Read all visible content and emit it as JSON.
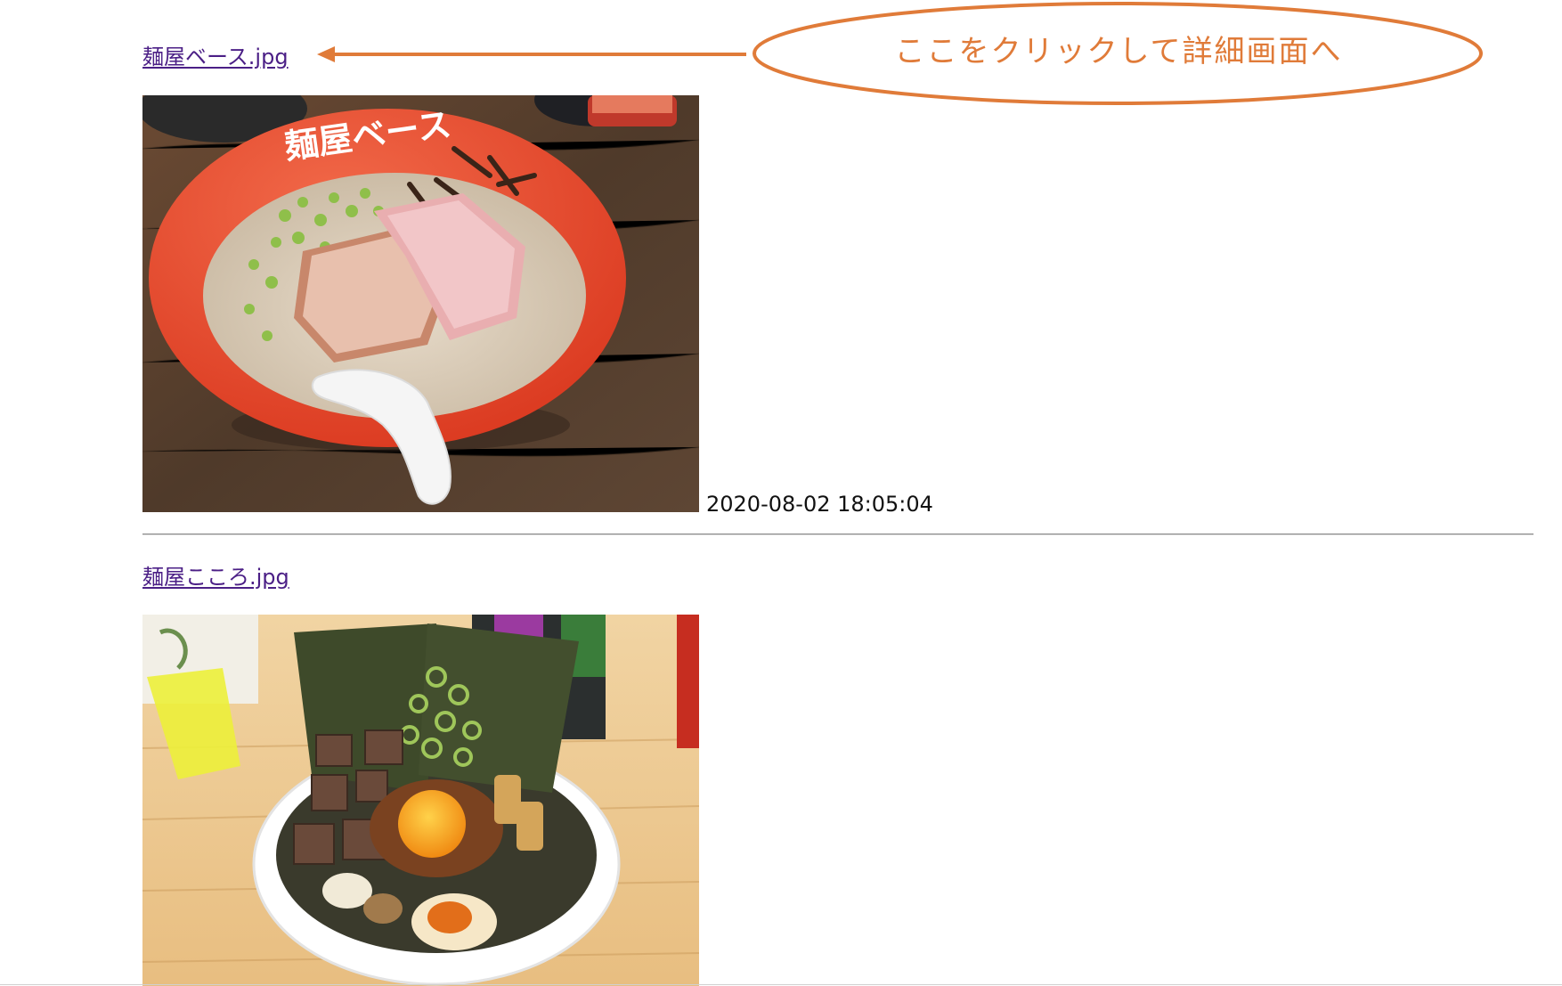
{
  "entries": [
    {
      "filename": "麺屋ベース.jpg",
      "timestamp": "2020-08-02 18:05:04",
      "bowl_text": "麺屋ベース",
      "photo_subject": "ramen-bowl"
    },
    {
      "filename": "麺屋こころ.jpg",
      "timestamp": "",
      "photo_subject": "mazesoba-bowl"
    }
  ],
  "annotation": {
    "callout": "ここをクリックして詳細画面へ",
    "color": "#e07b39"
  },
  "colors": {
    "link": "#4b1f86",
    "text": "#111111",
    "divider": "#8a8a8a",
    "bowl_red": "#e8452b",
    "table_wood": "#5b4230"
  }
}
